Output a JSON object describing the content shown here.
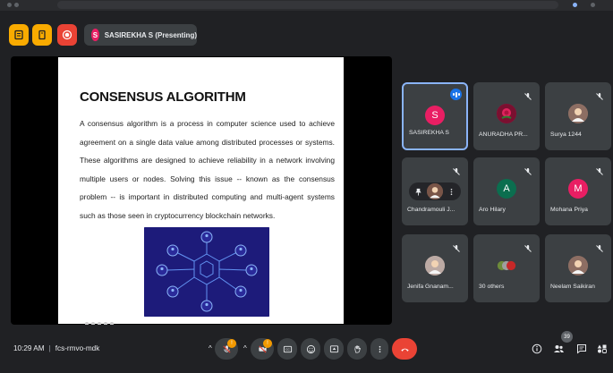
{
  "topbar": {
    "presenter_initial": "S",
    "presenting_label": "SASIREKHA S (Presenting)"
  },
  "slide": {
    "title": "CONSENSUS ALGORITHM",
    "body": "A consensus algorithm is a process in computer science used to achieve agreement on a single data value among distributed processes or systems. These algorithms are designed to achieve reliability in a network involving multiple users or nodes. Solving this issue -- known as the consensus problem -- is important in distributed computing and multi-agent systems such as those seen in cryptocurrency blockchain networks."
  },
  "participants": [
    {
      "name": "SASIREKHA S",
      "initial": "S",
      "color": "#e91e63",
      "active": true
    },
    {
      "name": "ANURADHA PR...",
      "initial": "",
      "color": "#c2185b",
      "photo": "rose"
    },
    {
      "name": "Surya 1244",
      "initial": "",
      "color": "#8d6e63",
      "photo": "person"
    },
    {
      "name": "Chandramouli J...",
      "initial": "",
      "color": "#795548",
      "photo": "person"
    },
    {
      "name": "Aro Hilary",
      "initial": "A",
      "color": "#0b6e4f"
    },
    {
      "name": "Mohana Priya",
      "initial": "M",
      "color": "#e91e63"
    },
    {
      "name": "Jenifa Gnanam...",
      "initial": "",
      "color": "#bcaaa4",
      "photo": "person"
    },
    {
      "name": "30 others",
      "initial": "",
      "color": "#5f6368",
      "photo": "group"
    },
    {
      "name": "Neelam Saikiran",
      "initial": "",
      "color": "#8d6e63",
      "photo": "person"
    }
  ],
  "bottombar": {
    "time": "10:29 AM",
    "meeting_code": "fcs-rmvo-mdk",
    "participant_count": "39",
    "mic_badge": "!",
    "cam_badge": "!"
  },
  "colors": {
    "background": "#202124",
    "tile": "#3c4043",
    "accent_blue": "#8ab4f8",
    "end_call": "#ea4335",
    "warning": "#f9ab00"
  }
}
